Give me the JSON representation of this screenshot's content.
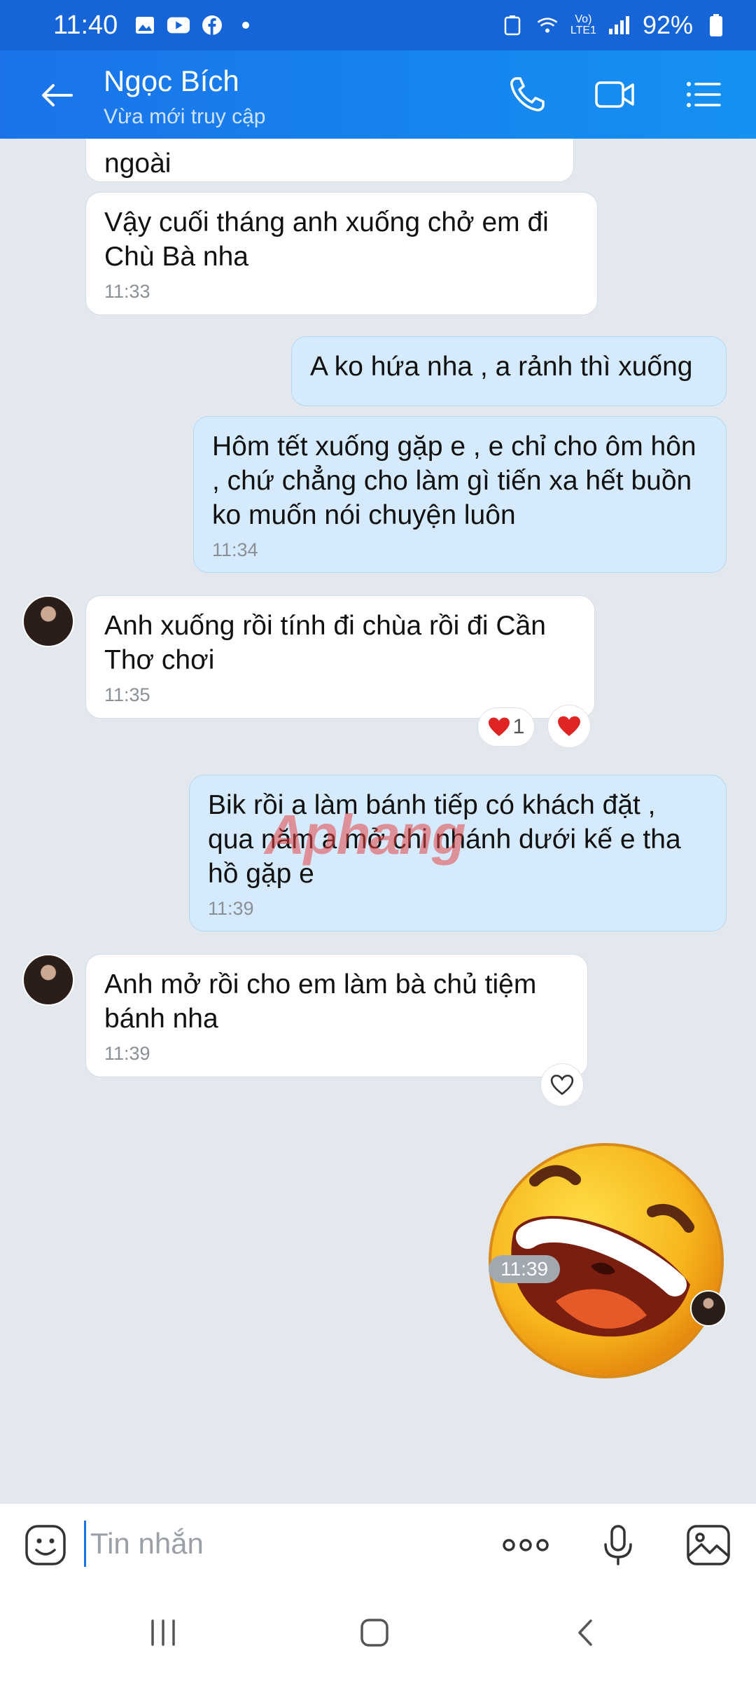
{
  "status": {
    "time": "11:40",
    "battery": "92%"
  },
  "header": {
    "name": "Ngọc Bích",
    "subtitle": "Vừa mới truy cập"
  },
  "messages": {
    "m0": {
      "text": "ngoài"
    },
    "m1": {
      "text": "Vậy cuối tháng anh xuống chở em đi Chù Bà nha",
      "time": "11:33"
    },
    "m2": {
      "text": "A ko hứa nha , a rảnh thì xuống"
    },
    "m3": {
      "text": "Hôm tết xuống gặp e , e chỉ cho ôm hôn , chứ chẳng cho làm gì tiến xa hết buồn ko muốn nói chuyện luôn",
      "time": "11:34"
    },
    "m4": {
      "text": "Anh xuống rồi tính đi chùa rồi đi Cần Thơ chơi",
      "time": "11:35",
      "reaction_count": "1"
    },
    "m5": {
      "text": "Bik rồi a làm bánh tiếp có khách đặt , qua năm a mở chi nhánh dưới kế e tha hồ gặp e",
      "time": "11:39"
    },
    "m6": {
      "text": "Anh mở rồi cho em làm bà chủ tiệm bánh nha",
      "time": "11:39"
    },
    "sticker_time": "11:39"
  },
  "watermark": "Aphang",
  "input": {
    "placeholder": "Tin nhắn"
  },
  "colors": {
    "header": "#1a73ea",
    "out_bubble": "#d5ebfd",
    "in_bubble": "#ffffff",
    "heart": "#e02424"
  },
  "icons": [
    "back-arrow-icon",
    "phone-icon",
    "video-icon",
    "menu-list-icon",
    "emoji-icon",
    "more-icon",
    "mic-icon",
    "image-icon",
    "heart-icon"
  ]
}
